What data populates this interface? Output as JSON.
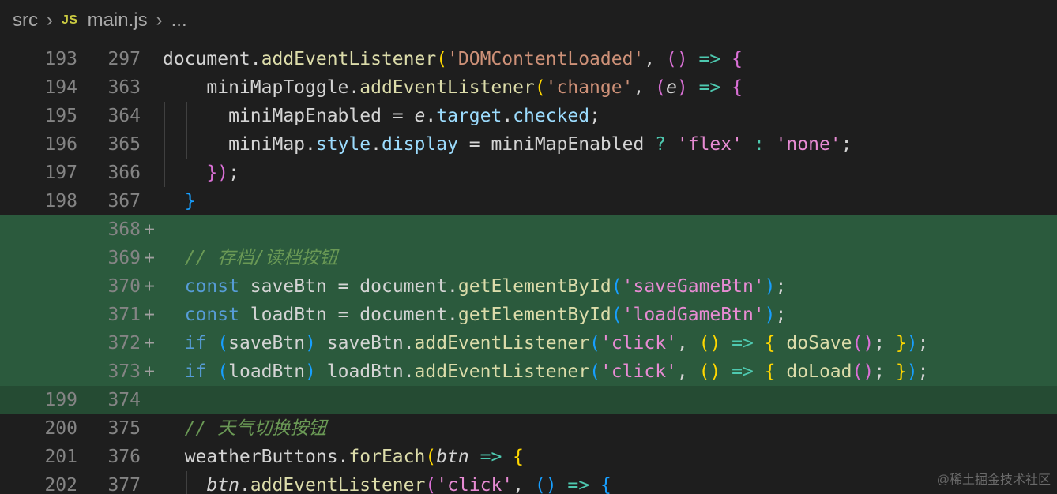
{
  "breadcrumb": {
    "folder": "src",
    "file_badge": "JS",
    "file": "main.js",
    "more": "...",
    "separator_icon": "chevron-right-icon"
  },
  "lines": [
    {
      "old": "193",
      "new": "297",
      "mark": "",
      "type": "normal",
      "tokens": [
        [
          "document.",
          ""
        ],
        [
          "addEventListener",
          "fn"
        ],
        [
          "(",
          "br1"
        ],
        [
          "'DOMContentLoaded'",
          "str"
        ],
        [
          ", ",
          ""
        ],
        [
          "()",
          "br2"
        ],
        [
          " => ",
          "op"
        ],
        [
          "{",
          "br2"
        ]
      ]
    },
    {
      "old": "194",
      "new": "363",
      "mark": "",
      "type": "normal",
      "tokens": [
        [
          "    miniMapToggle.",
          ""
        ],
        [
          "addEventListener",
          "fn"
        ],
        [
          "(",
          "br1"
        ],
        [
          "'change'",
          "str"
        ],
        [
          ", ",
          ""
        ],
        [
          "(",
          "br2"
        ],
        [
          "e",
          "par"
        ],
        [
          ")",
          "br2"
        ],
        [
          " => ",
          "op"
        ],
        [
          "{",
          "br2"
        ]
      ]
    },
    {
      "old": "195",
      "new": "364",
      "mark": "",
      "type": "normal",
      "tokens": [
        [
          "      miniMapEnabled = ",
          ""
        ],
        [
          "e",
          "par"
        ],
        [
          ".",
          ""
        ],
        [
          "target",
          "prop"
        ],
        [
          ".",
          ""
        ],
        [
          "checked",
          "prop"
        ],
        [
          ";",
          ""
        ]
      ]
    },
    {
      "old": "196",
      "new": "365",
      "mark": "",
      "type": "normal",
      "tokens": [
        [
          "      miniMap.",
          ""
        ],
        [
          "style",
          "prop"
        ],
        [
          ".",
          ""
        ],
        [
          "display",
          "prop"
        ],
        [
          " = miniMapEnabled ",
          ""
        ],
        [
          "?",
          "op"
        ],
        [
          " ",
          ""
        ],
        [
          "'flex'",
          "str2"
        ],
        [
          " ",
          ""
        ],
        [
          ":",
          "op"
        ],
        [
          " ",
          ""
        ],
        [
          "'none'",
          "str2"
        ],
        [
          ";",
          ""
        ]
      ]
    },
    {
      "old": "197",
      "new": "366",
      "mark": "",
      "type": "normal",
      "tokens": [
        [
          "    ",
          ""
        ],
        [
          "})",
          "br2"
        ],
        [
          ";",
          ""
        ]
      ]
    },
    {
      "old": "198",
      "new": "367",
      "mark": "",
      "type": "normal",
      "tokens": [
        [
          "  ",
          ""
        ],
        [
          "}",
          "br3"
        ]
      ]
    },
    {
      "old": "",
      "new": "368",
      "mark": "+",
      "type": "added",
      "tokens": []
    },
    {
      "old": "",
      "new": "369",
      "mark": "+",
      "type": "added",
      "tokens": [
        [
          "  // 存档/读档按钮",
          "cm"
        ]
      ]
    },
    {
      "old": "",
      "new": "370",
      "mark": "+",
      "type": "added",
      "tokens": [
        [
          "  ",
          ""
        ],
        [
          "const",
          "kw"
        ],
        [
          " saveBtn = document.",
          ""
        ],
        [
          "getElementById",
          "fn"
        ],
        [
          "(",
          "br3"
        ],
        [
          "'saveGameBtn'",
          "str2"
        ],
        [
          ")",
          "br3"
        ],
        [
          ";",
          ""
        ]
      ]
    },
    {
      "old": "",
      "new": "371",
      "mark": "+",
      "type": "added",
      "tokens": [
        [
          "  ",
          ""
        ],
        [
          "const",
          "kw"
        ],
        [
          " loadBtn = document.",
          ""
        ],
        [
          "getElementById",
          "fn"
        ],
        [
          "(",
          "br3"
        ],
        [
          "'loadGameBtn'",
          "str2"
        ],
        [
          ")",
          "br3"
        ],
        [
          ";",
          ""
        ]
      ]
    },
    {
      "old": "",
      "new": "372",
      "mark": "+",
      "type": "added",
      "tokens": [
        [
          "  ",
          ""
        ],
        [
          "if",
          "kw"
        ],
        [
          " ",
          ""
        ],
        [
          "(",
          "br3"
        ],
        [
          "saveBtn",
          ""
        ],
        [
          ")",
          "br3"
        ],
        [
          " saveBtn.",
          ""
        ],
        [
          "addEventListener",
          "fn"
        ],
        [
          "(",
          "br3"
        ],
        [
          "'click'",
          "str2"
        ],
        [
          ", ",
          ""
        ],
        [
          "()",
          "br1"
        ],
        [
          " => ",
          "op"
        ],
        [
          "{",
          "br1"
        ],
        [
          " ",
          ""
        ],
        [
          "doSave",
          "fn"
        ],
        [
          "()",
          "br2"
        ],
        [
          "; ",
          ""
        ],
        [
          "}",
          "br1"
        ],
        [
          ")",
          "br3"
        ],
        [
          ";",
          ""
        ]
      ]
    },
    {
      "old": "",
      "new": "373",
      "mark": "+",
      "type": "added",
      "tokens": [
        [
          "  ",
          ""
        ],
        [
          "if",
          "kw"
        ],
        [
          " ",
          ""
        ],
        [
          "(",
          "br3"
        ],
        [
          "loadBtn",
          ""
        ],
        [
          ")",
          "br3"
        ],
        [
          " loadBtn.",
          ""
        ],
        [
          "addEventListener",
          "fn"
        ],
        [
          "(",
          "br3"
        ],
        [
          "'click'",
          "str2"
        ],
        [
          ", ",
          ""
        ],
        [
          "()",
          "br1"
        ],
        [
          " => ",
          "op"
        ],
        [
          "{",
          "br1"
        ],
        [
          " ",
          ""
        ],
        [
          "doLoad",
          "fn"
        ],
        [
          "()",
          "br2"
        ],
        [
          "; ",
          ""
        ],
        [
          "}",
          "br1"
        ],
        [
          ")",
          "br3"
        ],
        [
          ";",
          ""
        ]
      ]
    },
    {
      "old": "199",
      "new": "374",
      "mark": "",
      "type": "blank",
      "tokens": []
    },
    {
      "old": "200",
      "new": "375",
      "mark": "",
      "type": "normal",
      "tokens": [
        [
          "  // 天气切换按钮",
          "cm"
        ]
      ]
    },
    {
      "old": "201",
      "new": "376",
      "mark": "",
      "type": "normal",
      "tokens": [
        [
          "  weatherButtons.",
          ""
        ],
        [
          "forEach",
          "fn"
        ],
        [
          "(",
          "br1"
        ],
        [
          "btn",
          "par"
        ],
        [
          " => ",
          "op"
        ],
        [
          "{",
          "br1"
        ]
      ]
    },
    {
      "old": "202",
      "new": "377",
      "mark": "",
      "type": "normal",
      "tokens": [
        [
          "    ",
          ""
        ],
        [
          "btn",
          "par"
        ],
        [
          ".",
          ""
        ],
        [
          "addEventListener",
          "fn"
        ],
        [
          "(",
          "br2"
        ],
        [
          "'click'",
          "str2"
        ],
        [
          ", ",
          ""
        ],
        [
          "()",
          "br3"
        ],
        [
          " => ",
          "op"
        ],
        [
          "{",
          "br3"
        ]
      ]
    }
  ],
  "watermark": "@稀土掘金技术社区"
}
